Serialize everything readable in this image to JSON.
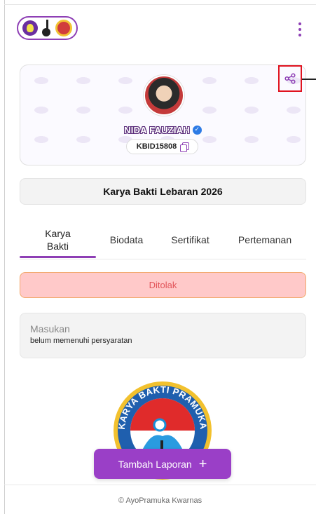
{
  "header": {
    "logos": [
      "scout-logo-icon",
      "music-note-logo-icon",
      "kwarnas-emblem-icon"
    ],
    "menu_icon": "kebab-menu-icon"
  },
  "profile": {
    "name": "NIDA FAUZIAH",
    "verified": true,
    "member_id": "KBID15808",
    "share_icon": "share-icon",
    "copy_icon": "copy-icon"
  },
  "activity": {
    "title": "Karya Bakti Lebaran 2026"
  },
  "tabs": [
    {
      "line1": "Karya",
      "line2": "Bakti",
      "active": true
    },
    {
      "line1": "Biodata",
      "line2": "",
      "active": false
    },
    {
      "line1": "Sertifikat",
      "line2": "",
      "active": false
    },
    {
      "line1": "Pertemanan",
      "line2": "",
      "active": false
    }
  ],
  "status": {
    "label": "Ditolak",
    "color": "#ffc9c9"
  },
  "feedback": {
    "label": "Masukan",
    "text": "belum memenuhi persyaratan"
  },
  "badge": {
    "arc_text": "KARYA BAKTI PRAMUKA"
  },
  "actions": {
    "add_report": "Tambah Laporan",
    "add_icon": "+"
  },
  "footer": {
    "text": "© AyoPramuka Kwarnas"
  },
  "colors": {
    "accent": "#8e3fb5",
    "button": "#9a3fc7",
    "status_text": "#e2555a",
    "highlight": "#e0131f"
  }
}
